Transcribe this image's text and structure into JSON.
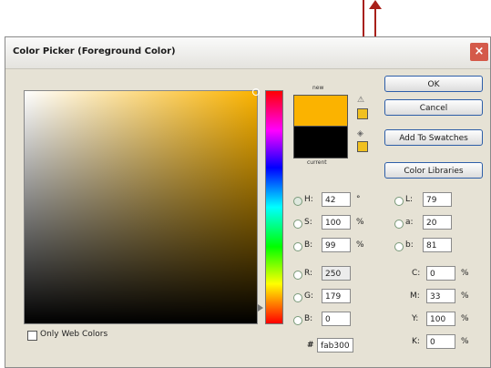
{
  "dialog": {
    "title": "Color Picker (Foreground Color)",
    "close_glyph": "×"
  },
  "swatches": {
    "new_label": "new",
    "current_label": "current",
    "new_color": "#fbb300",
    "current_color": "#000000"
  },
  "buttons": {
    "ok": "OK",
    "cancel": "Cancel",
    "add_to_swatches": "Add To Swatches",
    "color_libraries": "Color Libraries"
  },
  "hsb": {
    "h": {
      "label": "H:",
      "value": "42",
      "unit": "°"
    },
    "s": {
      "label": "S:",
      "value": "100",
      "unit": "%"
    },
    "b": {
      "label": "B:",
      "value": "99",
      "unit": "%"
    }
  },
  "rgb": {
    "r": {
      "label": "R:",
      "value": "250"
    },
    "g": {
      "label": "G:",
      "value": "179"
    },
    "b": {
      "label": "B:",
      "value": "0"
    }
  },
  "lab": {
    "l": {
      "label": "L:",
      "value": "79"
    },
    "a": {
      "label": "a:",
      "value": "20"
    },
    "b": {
      "label": "b:",
      "value": "81"
    }
  },
  "cmyk": {
    "c": {
      "label": "C:",
      "value": "0",
      "unit": "%"
    },
    "m": {
      "label": "M:",
      "value": "33",
      "unit": "%"
    },
    "y": {
      "label": "Y:",
      "value": "100",
      "unit": "%"
    },
    "k": {
      "label": "K:",
      "value": "0",
      "unit": "%"
    }
  },
  "hex": {
    "label": "#",
    "value": "fab300"
  },
  "only_web_colors": "Only Web Colors",
  "accent_color": "#a8201a"
}
